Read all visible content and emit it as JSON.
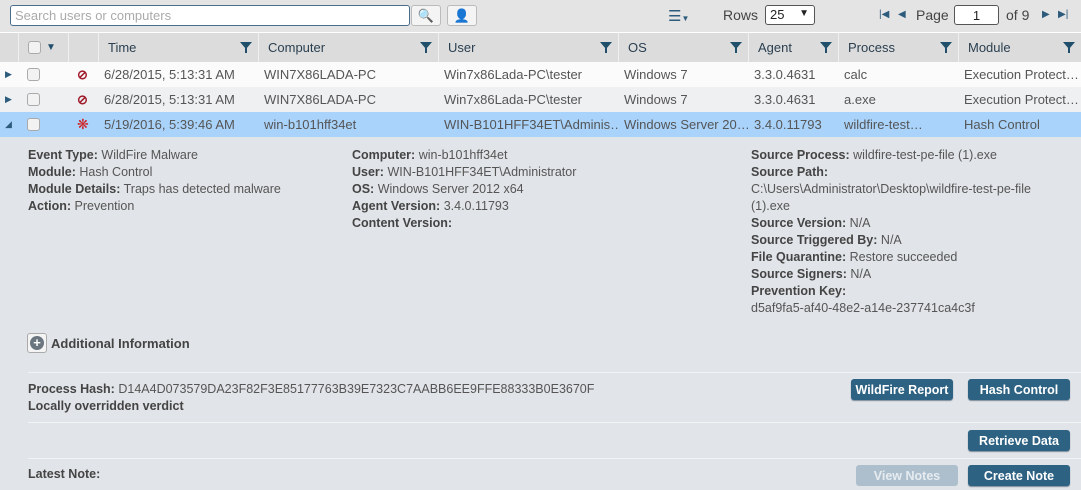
{
  "toolbar": {
    "search_placeholder": "Search users or computers",
    "rows_label": "Rows",
    "rows_value": "25",
    "page_label": "Page",
    "page_value": "1",
    "page_of": "of 9"
  },
  "columns": [
    "Time",
    "Computer",
    "User",
    "OS",
    "Agent",
    "Process",
    "Module"
  ],
  "rows": [
    {
      "time": "6/28/2015, 5:13:31 AM",
      "computer": "WIN7X86LADA-PC",
      "user": "Win7x86Lada-PC\\tester",
      "os": "Windows 7",
      "agent": "3.3.0.4631",
      "process": "calc",
      "module": "Execution Protect…",
      "icon": "block-icon"
    },
    {
      "time": "6/28/2015, 5:13:31 AM",
      "computer": "WIN7X86LADA-PC",
      "user": "Win7x86Lada-PC\\tester",
      "os": "Windows 7",
      "agent": "3.3.0.4631",
      "process": "a.exe",
      "module": "Execution Protect…",
      "icon": "block-icon"
    },
    {
      "time": "5/19/2016, 5:39:46 AM",
      "computer": "win-b101hff34et",
      "user": "WIN-B101HFF34ET\\Adminis…",
      "os": "Windows Server 20…",
      "agent": "3.4.0.11793",
      "process": "wildfire-test…",
      "module": "Hash Control",
      "icon": "malware-bug-icon"
    }
  ],
  "details": {
    "col1": [
      {
        "k": "Event Type:",
        "v": "WildFire Malware"
      },
      {
        "k": "Module:",
        "v": "Hash Control"
      },
      {
        "k": "Module Details:",
        "v": "Traps has detected malware"
      },
      {
        "k": "Action:",
        "v": "Prevention"
      }
    ],
    "col2": [
      {
        "k": "Computer:",
        "v": "win-b101hff34et"
      },
      {
        "k": "User:",
        "v": "WIN-B101HFF34ET\\Administrator"
      },
      {
        "k": "OS:",
        "v": "Windows Server 2012 x64"
      },
      {
        "k": "Agent Version:",
        "v": "3.4.0.11793"
      },
      {
        "k": "Content Version:",
        "v": ""
      }
    ],
    "col3": {
      "source_process_k": "Source Process:",
      "source_process_v": "wildfire-test-pe-file (1).exe",
      "source_path_k": "Source Path:",
      "source_path_v": "C:\\Users\\Administrator\\Desktop\\wildfire-test-pe-file (1).exe",
      "source_version_k": "Source Version:",
      "source_version_v": "N/A",
      "triggered_k": "Source Triggered By:",
      "triggered_v": "N/A",
      "quarantine_k": "File Quarantine:",
      "quarantine_v": "Restore succeeded",
      "signers_k": "Source Signers:",
      "signers_v": "N/A",
      "prevention_k": "Prevention Key:",
      "prevention_v": "d5af9fa5-af40-48e2-a14e-237741ca4c3f"
    },
    "additional_info": "Additional Information",
    "hash_k": "Process Hash:",
    "hash_v": "D14A4D073579DA23F82F3E85177763B39E7323C7AABB6EE9FFE88333B0E3670F",
    "verdict": "Locally overridden verdict",
    "latest_note": "Latest Note:"
  },
  "buttons": {
    "wildfire_report": "WildFire Report",
    "hash_control": "Hash Control",
    "retrieve_data": "Retrieve Data",
    "view_notes": "View Notes",
    "create_note": "Create Note"
  }
}
